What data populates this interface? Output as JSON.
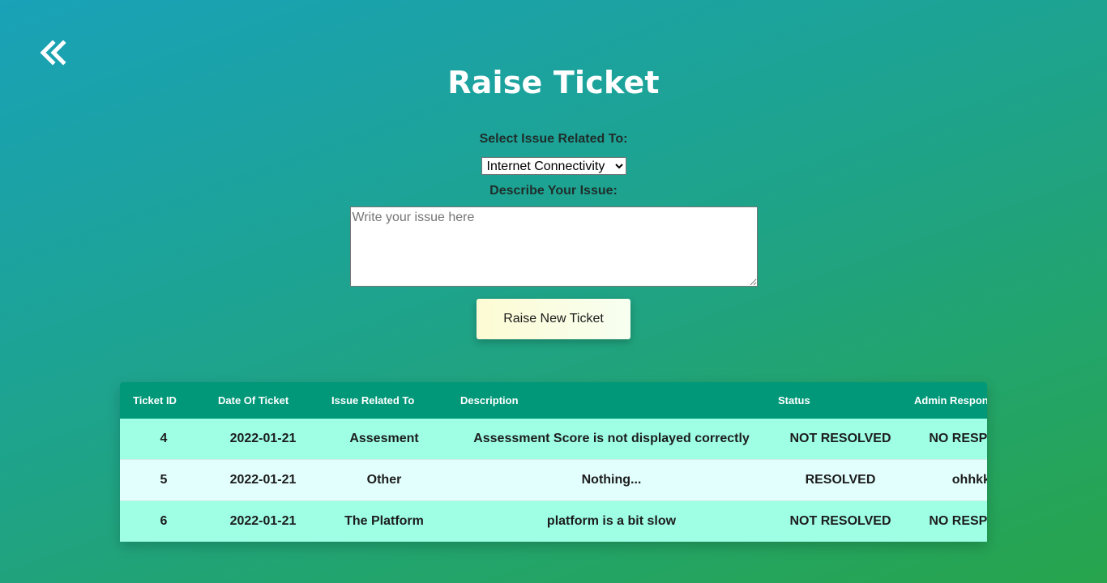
{
  "header": {
    "back_icon": "double-chevron-left-icon",
    "title": "Raise Ticket"
  },
  "form": {
    "select_label": "Select Issue Related To:",
    "selected_option": "Internet Connectivity",
    "describe_label": "Describe Your Issue:",
    "textarea_placeholder": "Write your issue here",
    "submit_label": "Raise New Ticket"
  },
  "table": {
    "headers": [
      "Ticket ID",
      "Date Of Ticket",
      "Issue Related To",
      "Description",
      "Status",
      "Admin Responce"
    ],
    "rows": [
      [
        "4",
        "2022-01-21",
        "Assesment",
        "Assessment Score is not displayed correctly",
        "NOT RESOLVED",
        "NO RESPONSE"
      ],
      [
        "5",
        "2022-01-21",
        "Other",
        "Nothing...",
        "RESOLVED",
        "ohhkk..."
      ],
      [
        "6",
        "2022-01-21",
        "The Platform",
        "platform is a bit slow",
        "NOT RESOLVED",
        "NO RESPONSE"
      ]
    ]
  },
  "colors": {
    "table_header": "#009879",
    "row_odd": "#9effe5",
    "row_even": "#e2fffd",
    "title_text": "#ffffff"
  }
}
